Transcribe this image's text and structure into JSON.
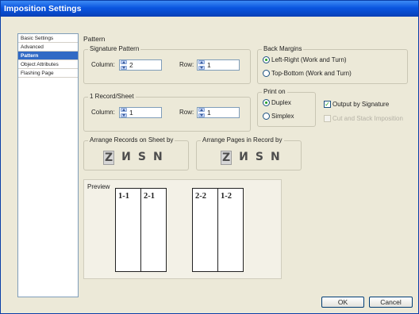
{
  "window": {
    "title": "Imposition Settings"
  },
  "sidebar": {
    "items": [
      {
        "label": "Basic Settings"
      },
      {
        "label": "Advanced"
      },
      {
        "label": "Pattern"
      },
      {
        "label": "Object Attributes"
      },
      {
        "label": "Flashing Page"
      }
    ],
    "active_index": 2
  },
  "panel": {
    "title": "Pattern",
    "signature": {
      "title": "Signature Pattern",
      "column_label": "Column:",
      "column_value": "2",
      "row_label": "Row:",
      "row_value": "1"
    },
    "record": {
      "title": "1 Record/Sheet",
      "column_label": "Column:",
      "column_value": "1",
      "row_label": "Row:",
      "row_value": "1"
    },
    "back_margins": {
      "title": "Back Margins",
      "option1": "Left-Right (Work and Turn)",
      "option2": "Top-Bottom (Work and Turn)",
      "selected": "option1"
    },
    "print_on": {
      "title": "Print on",
      "option1": "Duplex",
      "option2": "Simplex",
      "selected": "option1"
    },
    "output_by_signature": {
      "label": "Output by Signature",
      "checked": true
    },
    "cut_and_stack": {
      "label": "Cut and Stack Imposition",
      "checked": false,
      "disabled": true
    },
    "arrange_records": {
      "title": "Arrange Records on Sheet by",
      "glyphs": [
        "Z",
        "И",
        "S",
        "N"
      ],
      "selected": 0
    },
    "arrange_pages": {
      "title": "Arrange Pages in Record by",
      "glyphs": [
        "Z",
        "И",
        "S",
        "N"
      ],
      "selected": 0
    },
    "preview": {
      "title": "Preview",
      "front": [
        "1-1",
        "2-1"
      ],
      "back": [
        "2-2",
        "1-2"
      ]
    }
  },
  "buttons": {
    "ok": "OK",
    "cancel": "Cancel"
  }
}
